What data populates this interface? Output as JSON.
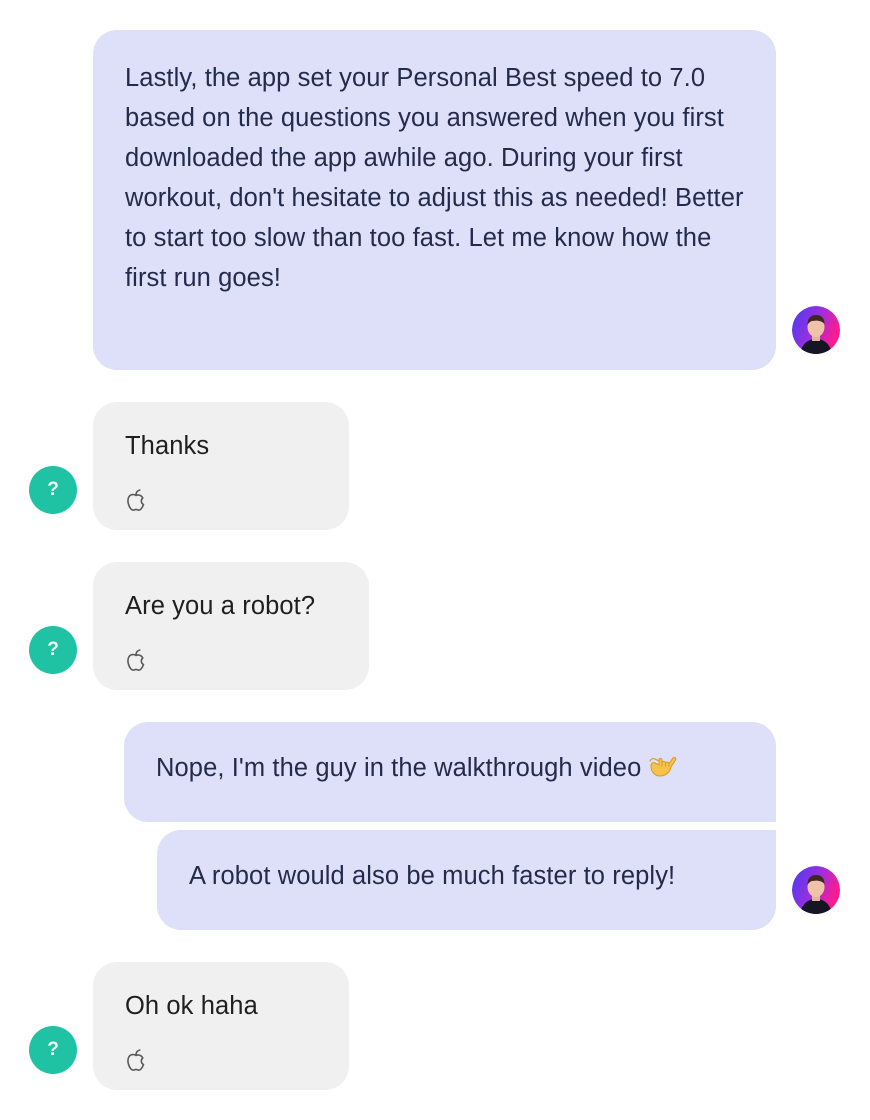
{
  "conversation": {
    "messages": [
      {
        "sender": "agent",
        "text": "Lastly, the app set your Personal Best speed to 7.0 based on the questions you answered when you first downloaded the app awhile ago. During your first workout, don't hesitate to adjust this as needed! Better to start too slow than too fast. Let me know how the first run goes!"
      },
      {
        "sender": "user",
        "text": "Thanks",
        "platform_icon": "apple-icon"
      },
      {
        "sender": "user",
        "text": "Are you a robot?",
        "platform_icon": "apple-icon"
      },
      {
        "sender": "agent",
        "text": "Nope, I'm the guy in the walkthrough video",
        "emoji": "call-me-hand-emoji"
      },
      {
        "sender": "agent",
        "text": "A robot would also be much faster to reply!"
      },
      {
        "sender": "user",
        "text": "Oh ok haha",
        "platform_icon": "apple-icon"
      }
    ],
    "user_avatar": {
      "glyph": "?",
      "color": "#1fc2a3"
    },
    "agent_avatar": {
      "icon": "agent-photo-avatar"
    }
  },
  "colors": {
    "agent_bubble": "#dde0f8",
    "agent_text": "#232b4d",
    "user_bubble": "#f0f0f0",
    "user_text": "#1f1f1f",
    "user_avatar": "#1fc2a3",
    "apple_icon": "#5a5a5a"
  }
}
